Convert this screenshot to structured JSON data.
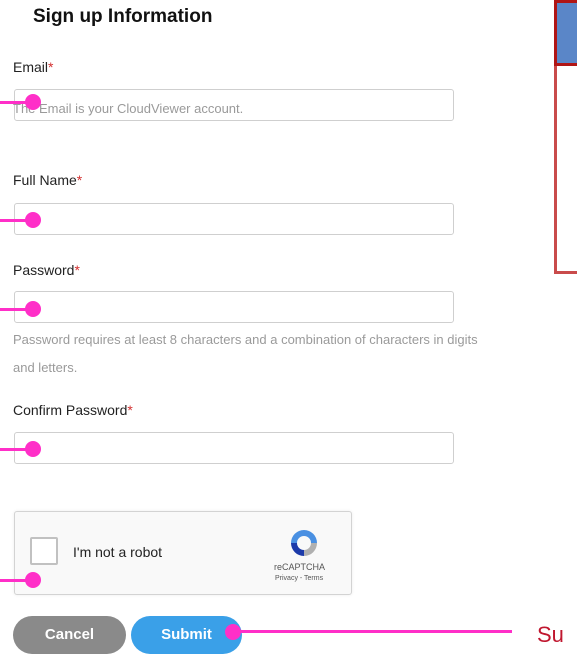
{
  "form": {
    "heading": "Sign up Information",
    "email": {
      "label": "Email",
      "required_mark": "*",
      "hint": "The Email is your CloudViewer account.",
      "value": ""
    },
    "full_name": {
      "label": "Full Name",
      "required_mark": "*",
      "value": ""
    },
    "password": {
      "label": "Password",
      "required_mark": "*",
      "hint_line1": "Password requires at least 8 characters and a combination of characters in digits",
      "hint_line2": "and letters.",
      "value": ""
    },
    "confirm_password": {
      "label": "Confirm Password",
      "required_mark": "*",
      "value": ""
    }
  },
  "captcha": {
    "checkbox_label": "I'm not a robot",
    "brand": "reCAPTCHA",
    "links": "Privacy - Terms",
    "checked": false
  },
  "buttons": {
    "cancel": "Cancel",
    "submit": "Submit"
  },
  "annotation": {
    "callout_text": "Su",
    "color": "#ff2fc8",
    "text_color": "#c0172f"
  },
  "colors": {
    "required": "#d32f2f",
    "submit_bg": "#3aa0e8",
    "cancel_bg": "#8a8a8a"
  }
}
